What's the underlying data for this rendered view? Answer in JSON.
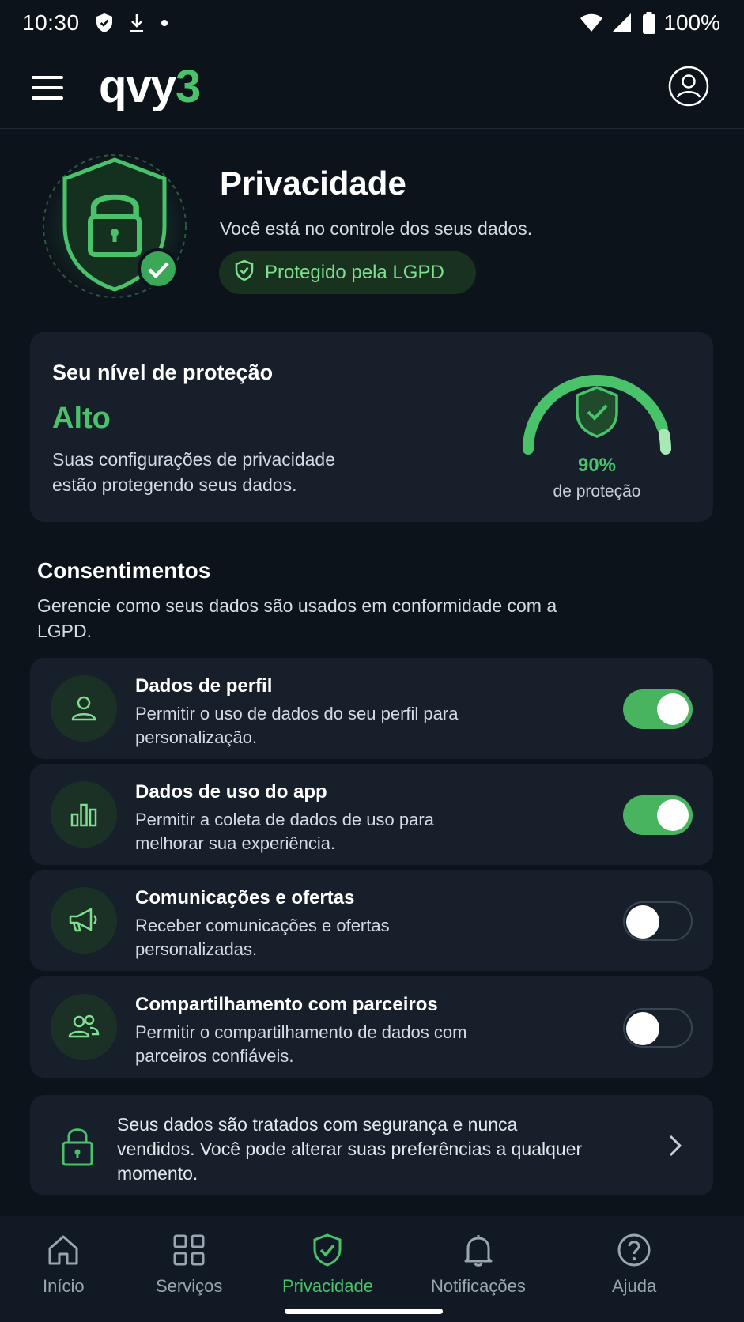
{
  "status_bar": {
    "time": "10:30",
    "battery": "100%",
    "icons": [
      "shield-icon",
      "download-icon",
      "dot-icon",
      "wifi-icon",
      "signal-icon",
      "battery-icon"
    ]
  },
  "app_bar": {
    "logo_main": "qvy",
    "logo_accent": "3",
    "menu_icon": "menu-icon",
    "profile_icon": "profile-icon"
  },
  "hero": {
    "title": "Privacidade",
    "subtitle": "Você está no controle dos seus dados.",
    "badge": "Protegido pela LGPD"
  },
  "protection": {
    "title": "Seu nível de proteção",
    "level": "Alto",
    "description": "Suas configurações de privacidade estão protegendo seus dados.",
    "percent_text": "90%",
    "percent_value": 90,
    "percent_label": "de proteção"
  },
  "consents": {
    "title": "Consentimentos",
    "description": "Gerencie como seus dados são usados em conformidade com a LGPD.",
    "items": [
      {
        "title": "Dados de perfil",
        "description": "Permitir o uso de dados do seu perfil para personalização.",
        "enabled": true,
        "icon": "user-icon"
      },
      {
        "title": "Dados de uso do app",
        "description": "Permitir a coleta de dados de uso para melhorar sua experiência.",
        "enabled": true,
        "icon": "bar-chart-icon"
      },
      {
        "title": "Comunicações e ofertas",
        "description": "Receber comunicações e ofertas personalizadas.",
        "enabled": false,
        "icon": "megaphone-icon"
      },
      {
        "title": "Compartilhamento com parceiros",
        "description": "Permitir o compartilhamento de dados com parceiros confiáveis.",
        "enabled": false,
        "icon": "users-icon"
      }
    ]
  },
  "info": {
    "text": "Seus dados são tratados com segurança e nunca vendidos. Você pode alterar suas preferências a qualquer momento."
  },
  "bottom_nav": {
    "items": [
      {
        "label": "Início",
        "icon": "home-icon",
        "active": false
      },
      {
        "label": "Serviços",
        "icon": "grid-icon",
        "active": false
      },
      {
        "label": "Privacidade",
        "icon": "shield-check-icon",
        "active": true
      },
      {
        "label": "Notificações",
        "icon": "bell-icon",
        "active": false
      },
      {
        "label": "Ajuda",
        "icon": "help-icon",
        "active": false
      }
    ]
  },
  "colors": {
    "accent": "#49c26a",
    "background": "#0c131b",
    "card": "#161f2a"
  }
}
